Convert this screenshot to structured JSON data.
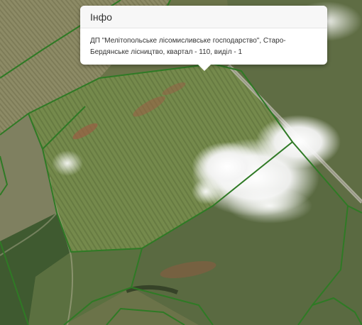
{
  "popup": {
    "title": "Інфо",
    "line1": "ДП \"Мелітопольське лісомисливське господарство\", Старо-",
    "line2": "Бердянське лісництво, квартал - 110, виділ - 1"
  },
  "map": {
    "basemap": "satellite",
    "boundary_color": "#2f7a25"
  }
}
